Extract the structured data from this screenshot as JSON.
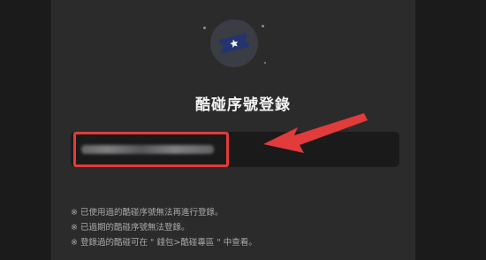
{
  "dialog": {
    "title": "酷碰序號登錄",
    "icon": "ticket-star-icon",
    "input": {
      "placeholder": "",
      "value_obscured": true
    }
  },
  "notes": [
    "※ 已使用過的酷碰序號無法再進行登錄。",
    "※ 已過期的酷碰序號無法登錄。",
    "※ 登錄過的酷碰可在 \" 錢包>酷碰專區 \" 中查看。"
  ],
  "annotation": {
    "highlight_color": "#e23b3b",
    "arrow_color": "#e23b3b"
  },
  "colors": {
    "background": "#2b2b2c",
    "ticket": "#24346e",
    "text": "#f2f2f2"
  }
}
